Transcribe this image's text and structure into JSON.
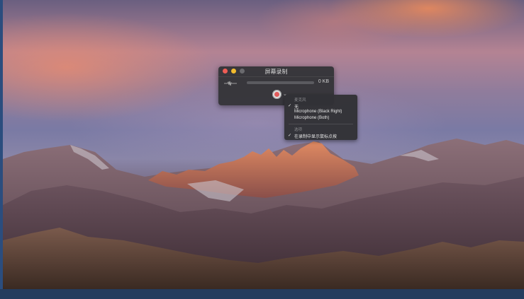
{
  "window": {
    "title": "屏幕录制",
    "file_size": "0 KB"
  },
  "options_menu": {
    "microphone_header": "麦克风",
    "microphone_items": [
      {
        "label": "无",
        "checked": true
      },
      {
        "label": "Microphone (Black Right)",
        "checked": false
      },
      {
        "label": "Microphone (Both)",
        "checked": false
      }
    ],
    "options_header": "选项",
    "options_items": [
      {
        "label": "在录制中显示鼠标点按",
        "checked": true
      }
    ],
    "check_glyph": "✓"
  },
  "colors": {
    "close": "#ee5d55",
    "minimize": "#f2bb2e",
    "record": "#e25a5a"
  }
}
